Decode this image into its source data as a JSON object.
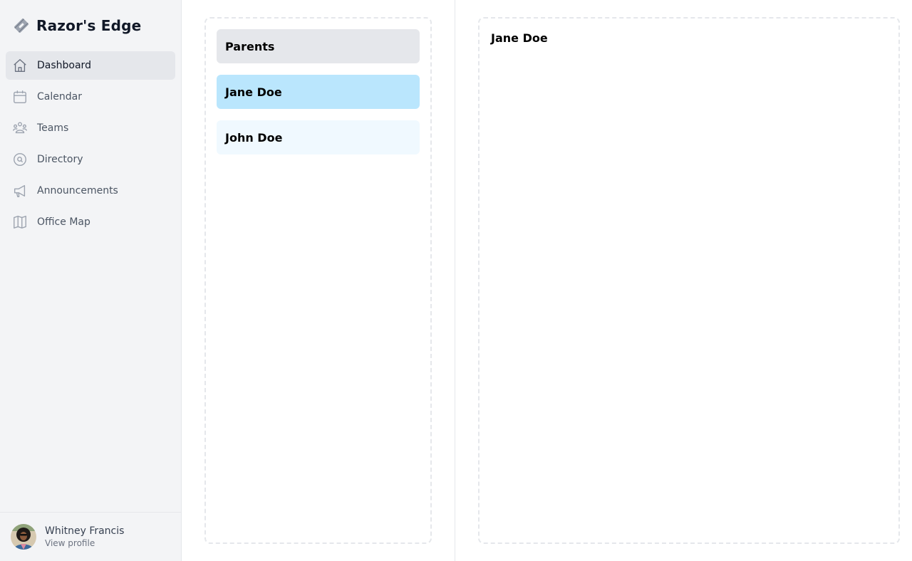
{
  "app": {
    "name": "Razor's Edge",
    "logo_icon": "razor-blade-icon"
  },
  "sidebar": {
    "items": [
      {
        "label": "Dashboard",
        "icon": "home-icon",
        "active": true
      },
      {
        "label": "Calendar",
        "icon": "calendar-icon",
        "active": false
      },
      {
        "label": "Teams",
        "icon": "users-icon",
        "active": false
      },
      {
        "label": "Directory",
        "icon": "search-circle-icon",
        "active": false
      },
      {
        "label": "Announcements",
        "icon": "megaphone-icon",
        "active": false
      },
      {
        "label": "Office Map",
        "icon": "map-icon",
        "active": false
      }
    ]
  },
  "profile": {
    "name": "Whitney Francis",
    "link": "View profile"
  },
  "list": {
    "header": "Parents",
    "items": [
      {
        "name": "Jane Doe",
        "selected": true
      },
      {
        "name": "John Doe",
        "selected": false
      }
    ]
  },
  "detail": {
    "title": "Jane Doe"
  },
  "colors": {
    "selected": "#bae6fd",
    "item": "#f0f9ff",
    "header": "#e5e7eb",
    "sidebar": "#f3f4f6"
  }
}
